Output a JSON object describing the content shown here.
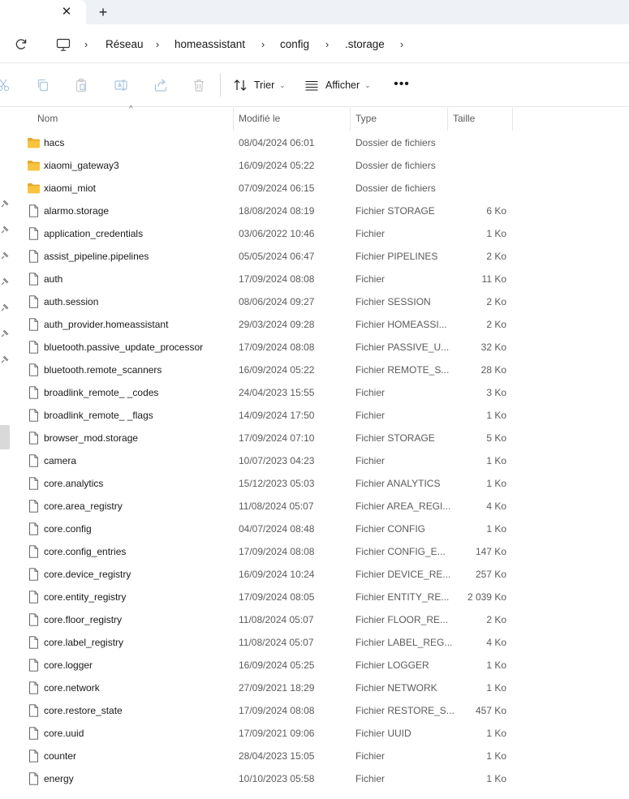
{
  "tabs": {
    "close_glyph": "✕",
    "new_glyph": "+"
  },
  "breadcrumb": {
    "items": [
      "Réseau",
      "homeassistant",
      "config",
      ".storage"
    ],
    "separator": "›"
  },
  "toolbar": {
    "sort_label": "Trier",
    "view_label": "Afficher",
    "more_glyph": "•••"
  },
  "columns": {
    "name": "Nom",
    "modified": "Modifié le",
    "type": "Type",
    "size": "Taille"
  },
  "colors": {
    "folder": "#f8c43e",
    "folder_dark": "#e5a82a",
    "accent": "#0067c0"
  },
  "files": [
    {
      "name": "hacs",
      "date": "08/04/2024 06:01",
      "type": "Dossier de fichiers",
      "size": "",
      "kind": "folder"
    },
    {
      "name": "xiaomi_gateway3",
      "date": "16/09/2024 05:22",
      "type": "Dossier de fichiers",
      "size": "",
      "kind": "folder"
    },
    {
      "name": "xiaomi_miot",
      "date": "07/09/2024 06:15",
      "type": "Dossier de fichiers",
      "size": "",
      "kind": "folder"
    },
    {
      "name": "alarmo.storage",
      "date": "18/08/2024 08:19",
      "type": "Fichier STORAGE",
      "size": "6 Ko",
      "kind": "file"
    },
    {
      "name": "application_credentials",
      "date": "03/06/2022 10:46",
      "type": "Fichier",
      "size": "1 Ko",
      "kind": "file"
    },
    {
      "name": "assist_pipeline.pipelines",
      "date": "05/05/2024 06:47",
      "type": "Fichier PIPELINES",
      "size": "2 Ko",
      "kind": "file"
    },
    {
      "name": "auth",
      "date": "17/09/2024 08:08",
      "type": "Fichier",
      "size": "11 Ko",
      "kind": "file"
    },
    {
      "name": "auth.session",
      "date": "08/06/2024 09:27",
      "type": "Fichier SESSION",
      "size": "2 Ko",
      "kind": "file"
    },
    {
      "name": "auth_provider.homeassistant",
      "date": "29/03/2024 09:28",
      "type": "Fichier HOMEASSI...",
      "size": "2 Ko",
      "kind": "file"
    },
    {
      "name": "bluetooth.passive_update_processor",
      "date": "17/09/2024 08:08",
      "type": "Fichier PASSIVE_U...",
      "size": "32 Ko",
      "kind": "file"
    },
    {
      "name": "bluetooth.remote_scanners",
      "date": "16/09/2024 05:22",
      "type": "Fichier REMOTE_S...",
      "size": "28 Ko",
      "kind": "file"
    },
    {
      "name": "broadlink_remote_                    _codes",
      "date": "24/04/2023 15:55",
      "type": "Fichier",
      "size": "3 Ko",
      "kind": "file"
    },
    {
      "name": "broadlink_remote_                    _flags",
      "date": "14/09/2024 17:50",
      "type": "Fichier",
      "size": "1 Ko",
      "kind": "file"
    },
    {
      "name": "browser_mod.storage",
      "date": "17/09/2024 07:10",
      "type": "Fichier STORAGE",
      "size": "5 Ko",
      "kind": "file"
    },
    {
      "name": "camera",
      "date": "10/07/2023 04:23",
      "type": "Fichier",
      "size": "1 Ko",
      "kind": "file"
    },
    {
      "name": "core.analytics",
      "date": "15/12/2023 05:03",
      "type": "Fichier ANALYTICS",
      "size": "1 Ko",
      "kind": "file"
    },
    {
      "name": "core.area_registry",
      "date": "11/08/2024 05:07",
      "type": "Fichier AREA_REGI...",
      "size": "4 Ko",
      "kind": "file"
    },
    {
      "name": "core.config",
      "date": "04/07/2024 08:48",
      "type": "Fichier CONFIG",
      "size": "1 Ko",
      "kind": "file"
    },
    {
      "name": "core.config_entries",
      "date": "17/09/2024 08:08",
      "type": "Fichier CONFIG_E...",
      "size": "147 Ko",
      "kind": "file"
    },
    {
      "name": "core.device_registry",
      "date": "16/09/2024 10:24",
      "type": "Fichier DEVICE_RE...",
      "size": "257 Ko",
      "kind": "file"
    },
    {
      "name": "core.entity_registry",
      "date": "17/09/2024 08:05",
      "type": "Fichier ENTITY_RE...",
      "size": "2 039 Ko",
      "kind": "file"
    },
    {
      "name": "core.floor_registry",
      "date": "11/08/2024 05:07",
      "type": "Fichier FLOOR_RE...",
      "size": "2 Ko",
      "kind": "file"
    },
    {
      "name": "core.label_registry",
      "date": "11/08/2024 05:07",
      "type": "Fichier LABEL_REG...",
      "size": "4 Ko",
      "kind": "file"
    },
    {
      "name": "core.logger",
      "date": "16/09/2024 05:25",
      "type": "Fichier LOGGER",
      "size": "1 Ko",
      "kind": "file"
    },
    {
      "name": "core.network",
      "date": "27/09/2021 18:29",
      "type": "Fichier NETWORK",
      "size": "1 Ko",
      "kind": "file"
    },
    {
      "name": "core.restore_state",
      "date": "17/09/2024 08:08",
      "type": "Fichier RESTORE_S...",
      "size": "457 Ko",
      "kind": "file"
    },
    {
      "name": "core.uuid",
      "date": "17/09/2021 09:06",
      "type": "Fichier UUID",
      "size": "1 Ko",
      "kind": "file"
    },
    {
      "name": "counter",
      "date": "28/04/2023 15:05",
      "type": "Fichier",
      "size": "1 Ko",
      "kind": "file"
    },
    {
      "name": "energy",
      "date": "10/10/2023 05:58",
      "type": "Fichier",
      "size": "1 Ko",
      "kind": "file"
    }
  ]
}
